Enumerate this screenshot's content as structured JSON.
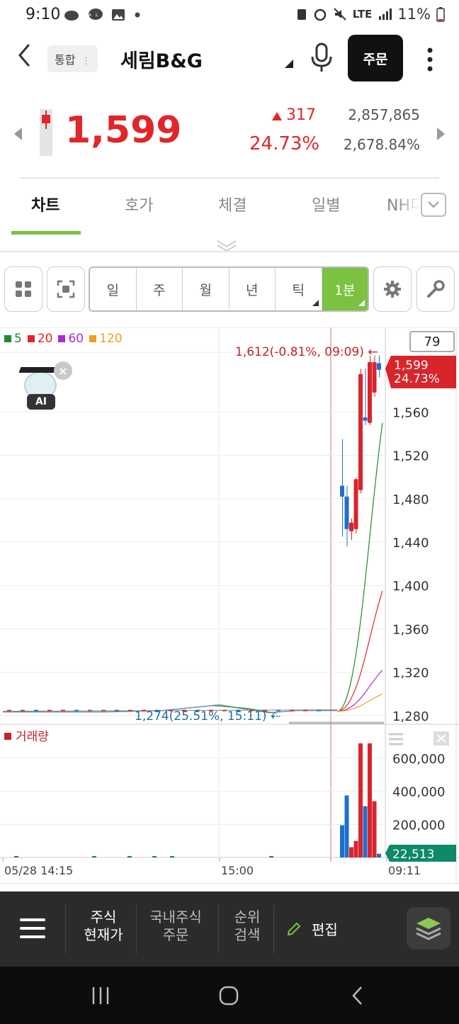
{
  "status_bar": {
    "time": "9:10",
    "left_icons": [
      "pig-icon",
      "talk-icon",
      "image-icon",
      "dot-icon"
    ],
    "network": "LTE",
    "battery": "11%"
  },
  "header": {
    "back_icon": "back-arrow-icon",
    "market_tag": "통합",
    "stock_name": "세림B&G",
    "order_label": "주문"
  },
  "quote": {
    "price": "1,599",
    "change": "317",
    "change_pct": "24.73%",
    "volume": "2,857,865",
    "volume_ratio": "2,678.84%",
    "color_up": "#e0262b"
  },
  "tabs": [
    {
      "label": "차트",
      "active": true
    },
    {
      "label": "호가",
      "active": false
    },
    {
      "label": "체결",
      "active": false
    },
    {
      "label": "일별",
      "active": false
    },
    {
      "label": "NH디",
      "active": false
    }
  ],
  "toolbar": {
    "periods": [
      {
        "label": "일",
        "active": false
      },
      {
        "label": "주",
        "active": false
      },
      {
        "label": "월",
        "active": false
      },
      {
        "label": "년",
        "active": false
      },
      {
        "label": "틱",
        "active": false,
        "dropdown": true
      },
      {
        "label": "1분",
        "active": true,
        "dropdown": true
      }
    ],
    "accent": "#7cc142"
  },
  "chart": {
    "legend": [
      {
        "label": "5",
        "color": "#1f8a2e"
      },
      {
        "label": "20",
        "color": "#e0262b"
      },
      {
        "label": "60",
        "color": "#b026d8"
      },
      {
        "label": "120",
        "color": "#f0a020"
      }
    ],
    "candle_count": "79",
    "ai_label": "AI",
    "high_marker": "1,612(-0.81%, 09:09)",
    "low_marker": "1,274(25.51%, 15:11)",
    "current_price": "1,599",
    "current_pct": "24.73%",
    "volume_label": "거래량",
    "current_volume": "22,513",
    "x_labels": [
      "05/28 14:15",
      "15:00",
      "09:11"
    ]
  },
  "chart_data": {
    "type": "candlestick",
    "interval": "1분",
    "price_axis": {
      "ticks": [
        1560,
        1520,
        1480,
        1440,
        1400,
        1360,
        1320,
        1280
      ],
      "tick_labels": [
        "1,560",
        "1,520",
        "1,480",
        "1,440",
        "1,400",
        "1,360",
        "1,320",
        "1,280"
      ],
      "range": [
        1272,
        1625
      ]
    },
    "volume_axis": {
      "ticks": [
        200000,
        400000,
        600000
      ],
      "tick_labels": [
        "200,000",
        "400,000",
        "600,000"
      ],
      "range": [
        0,
        780000
      ]
    },
    "candles": [
      {
        "o": 1492,
        "h": 1535,
        "l": 1445,
        "c": 1482,
        "vol": 195000
      },
      {
        "o": 1482,
        "h": 1492,
        "l": 1436,
        "c": 1452,
        "vol": 375000
      },
      {
        "o": 1450,
        "h": 1462,
        "l": 1442,
        "c": 1458,
        "vol": 62000
      },
      {
        "o": 1452,
        "h": 1500,
        "l": 1448,
        "c": 1498,
        "vol": 100000
      },
      {
        "o": 1488,
        "h": 1600,
        "l": 1485,
        "c": 1595,
        "vol": 690000
      },
      {
        "o": 1555,
        "h": 1600,
        "l": 1548,
        "c": 1552,
        "vol": 310000
      },
      {
        "o": 1550,
        "h": 1612,
        "l": 1548,
        "c": 1606,
        "vol": 690000
      },
      {
        "o": 1578,
        "h": 1612,
        "l": 1574,
        "c": 1606,
        "vol": 340000
      },
      {
        "o": 1605,
        "h": 1612,
        "l": 1592,
        "c": 1599,
        "vol": 22513
      }
    ],
    "ma": {
      "5": {
        "end": 1550,
        "color": "#1f8a2e"
      },
      "20": {
        "end": 1395,
        "color": "#e0262b"
      },
      "60": {
        "end": 1322,
        "color": "#b026d8"
      },
      "120": {
        "end": 1300,
        "color": "#f0a020"
      }
    },
    "flat_price": 1284
  },
  "bottom_nav": {
    "items": [
      {
        "line1": "주식",
        "line2": "현재가",
        "active": true
      },
      {
        "line1": "국내주식",
        "line2": "주문",
        "active": false
      },
      {
        "line1": "순위",
        "line2": "검색",
        "active": false
      }
    ],
    "edit_label": "편집"
  }
}
